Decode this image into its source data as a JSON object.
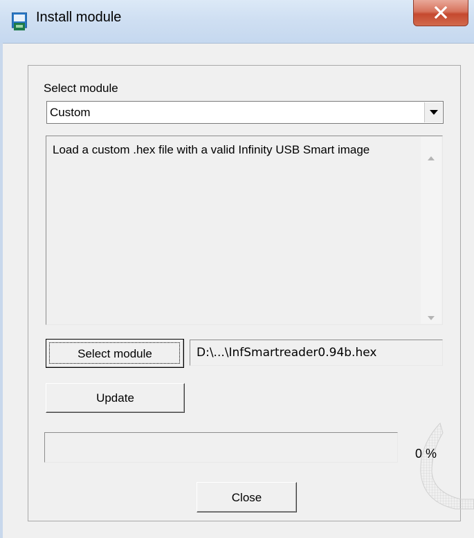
{
  "window": {
    "title": "Install module"
  },
  "module_select": {
    "label": "Select module",
    "selected": "Custom"
  },
  "description": {
    "text": "Load a custom .hex file with a valid Infinity USB Smart image"
  },
  "buttons": {
    "select_module": "Select module",
    "update": "Update",
    "close": "Close"
  },
  "file_path": {
    "value": "D:\\...\\InfSmartreader0.94b.hex"
  },
  "progress": {
    "value": 0,
    "label": "0 %"
  },
  "icons": {
    "title": "installer-icon",
    "close": "close-icon",
    "dropdown": "chevron-down-icon",
    "scroll_up": "scroll-up-icon",
    "scroll_down": "scroll-down-icon",
    "spinner": "loading-spinner-icon"
  },
  "colors": {
    "titlebar": "#cfdff2",
    "close_button": "#c5492f",
    "window_bg": "#f0f0f0"
  }
}
